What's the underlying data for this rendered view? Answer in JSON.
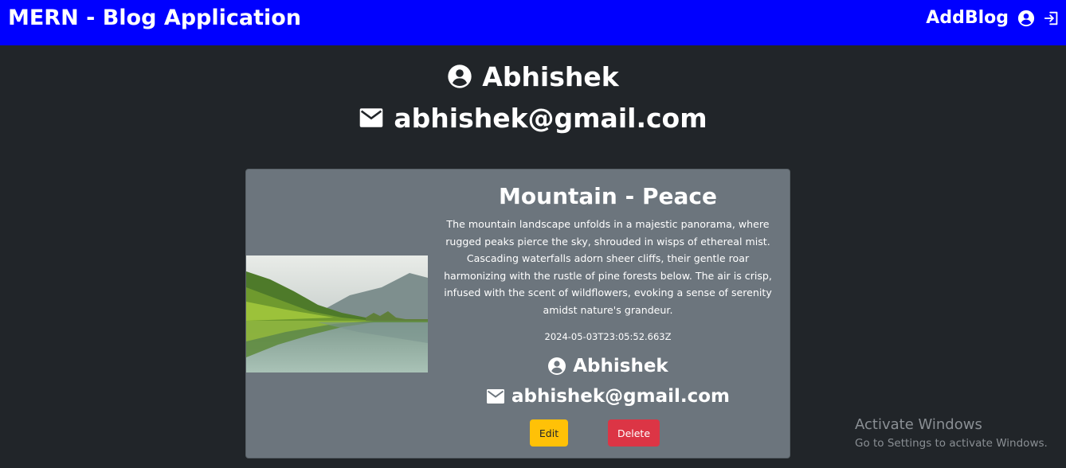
{
  "navbar": {
    "title": "MERN - Blog Application",
    "add_blog_label": "AddBlog",
    "bg_color": "#0000ff"
  },
  "profile": {
    "name": "Abhishek",
    "email": "abhishek@gmail.com"
  },
  "blog": {
    "title": "Mountain - Peace",
    "description": "The mountain landscape unfolds in a majestic panorama, where rugged peaks pierce the sky, shrouded in wisps of ethereal mist. Cascading waterfalls adorn sheer cliffs, their gentle roar harmonizing with the rustle of pine forests below. The air is crisp, infused with the scent of wildflowers, evoking a sense of serenity amidst nature's grandeur.",
    "date": "2024-05-03T23:05:52.663Z",
    "author_name": "Abhishek",
    "author_email": "abhishek@gmail.com",
    "edit_label": "Edit",
    "delete_label": "Delete"
  },
  "watermark": {
    "title": "Activate Windows",
    "subtitle": "Go to Settings to activate Windows."
  },
  "icons": {
    "user": "user-circle-icon",
    "mail": "mail-icon",
    "logout": "logout-icon"
  },
  "colors": {
    "background": "#212529",
    "card": "#6c757d",
    "edit_button": "#ffc107",
    "delete_button": "#dc3545"
  }
}
